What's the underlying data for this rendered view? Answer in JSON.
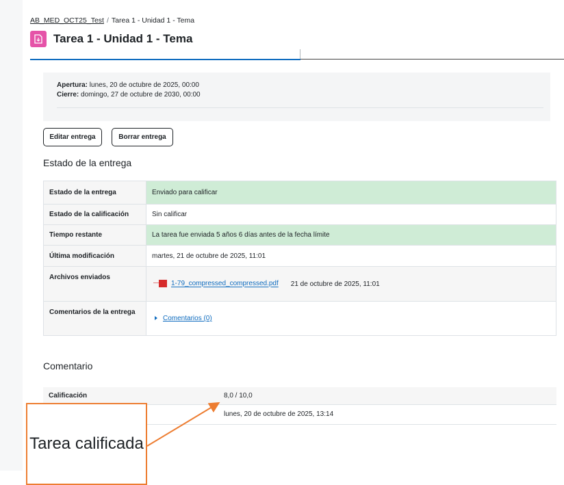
{
  "breadcrumb": {
    "course": "AB_MED_OCT25_Test",
    "separator": "/",
    "current": "Tarea 1 - Unidad 1 - Tema"
  },
  "page": {
    "title": "Tarea 1 - Unidad 1 - Tema",
    "icon": "assignment-icon",
    "accent": "#e553a8"
  },
  "dates": {
    "open_label": "Apertura:",
    "open_value": " lunes, 20 de octubre de 2025, 00:00",
    "close_label": "Cierre:",
    "close_value": " domingo, 27 de octubre de 2030, 00:00"
  },
  "buttons": {
    "edit": "Editar entrega",
    "delete": "Borrar entrega"
  },
  "submission": {
    "heading": "Estado de la entrega",
    "rows": [
      {
        "label": "Estado de la entrega",
        "value": "Enviado para calificar"
      },
      {
        "label": "Estado de la calificación",
        "value": "Sin calificar"
      },
      {
        "label": "Tiempo restante",
        "value": "La tarea fue enviada 5 años 6 días antes de la fecha límite"
      },
      {
        "label": "Última modificación",
        "value": "martes, 21 de octubre de 2025, 11:01"
      },
      {
        "label": "Archivos enviados",
        "file_name": "1-79_compressed_compressed.pdf",
        "file_date": "21 de octubre de 2025, 11:01"
      },
      {
        "label": "Comentarios de la entrega",
        "comments_link": "Comentarios (0)"
      }
    ]
  },
  "feedback": {
    "heading": "Comentario",
    "grade_label": "Calificación",
    "grade_value": "8,0 / 10,0",
    "graded_on": "lunes, 20 de octubre de 2025, 13:14"
  },
  "callout": {
    "text": "Tarea calificada",
    "color": "#ed7d31"
  },
  "colors": {
    "link": "#0f6cbf",
    "success_row": "#cfecd6"
  }
}
